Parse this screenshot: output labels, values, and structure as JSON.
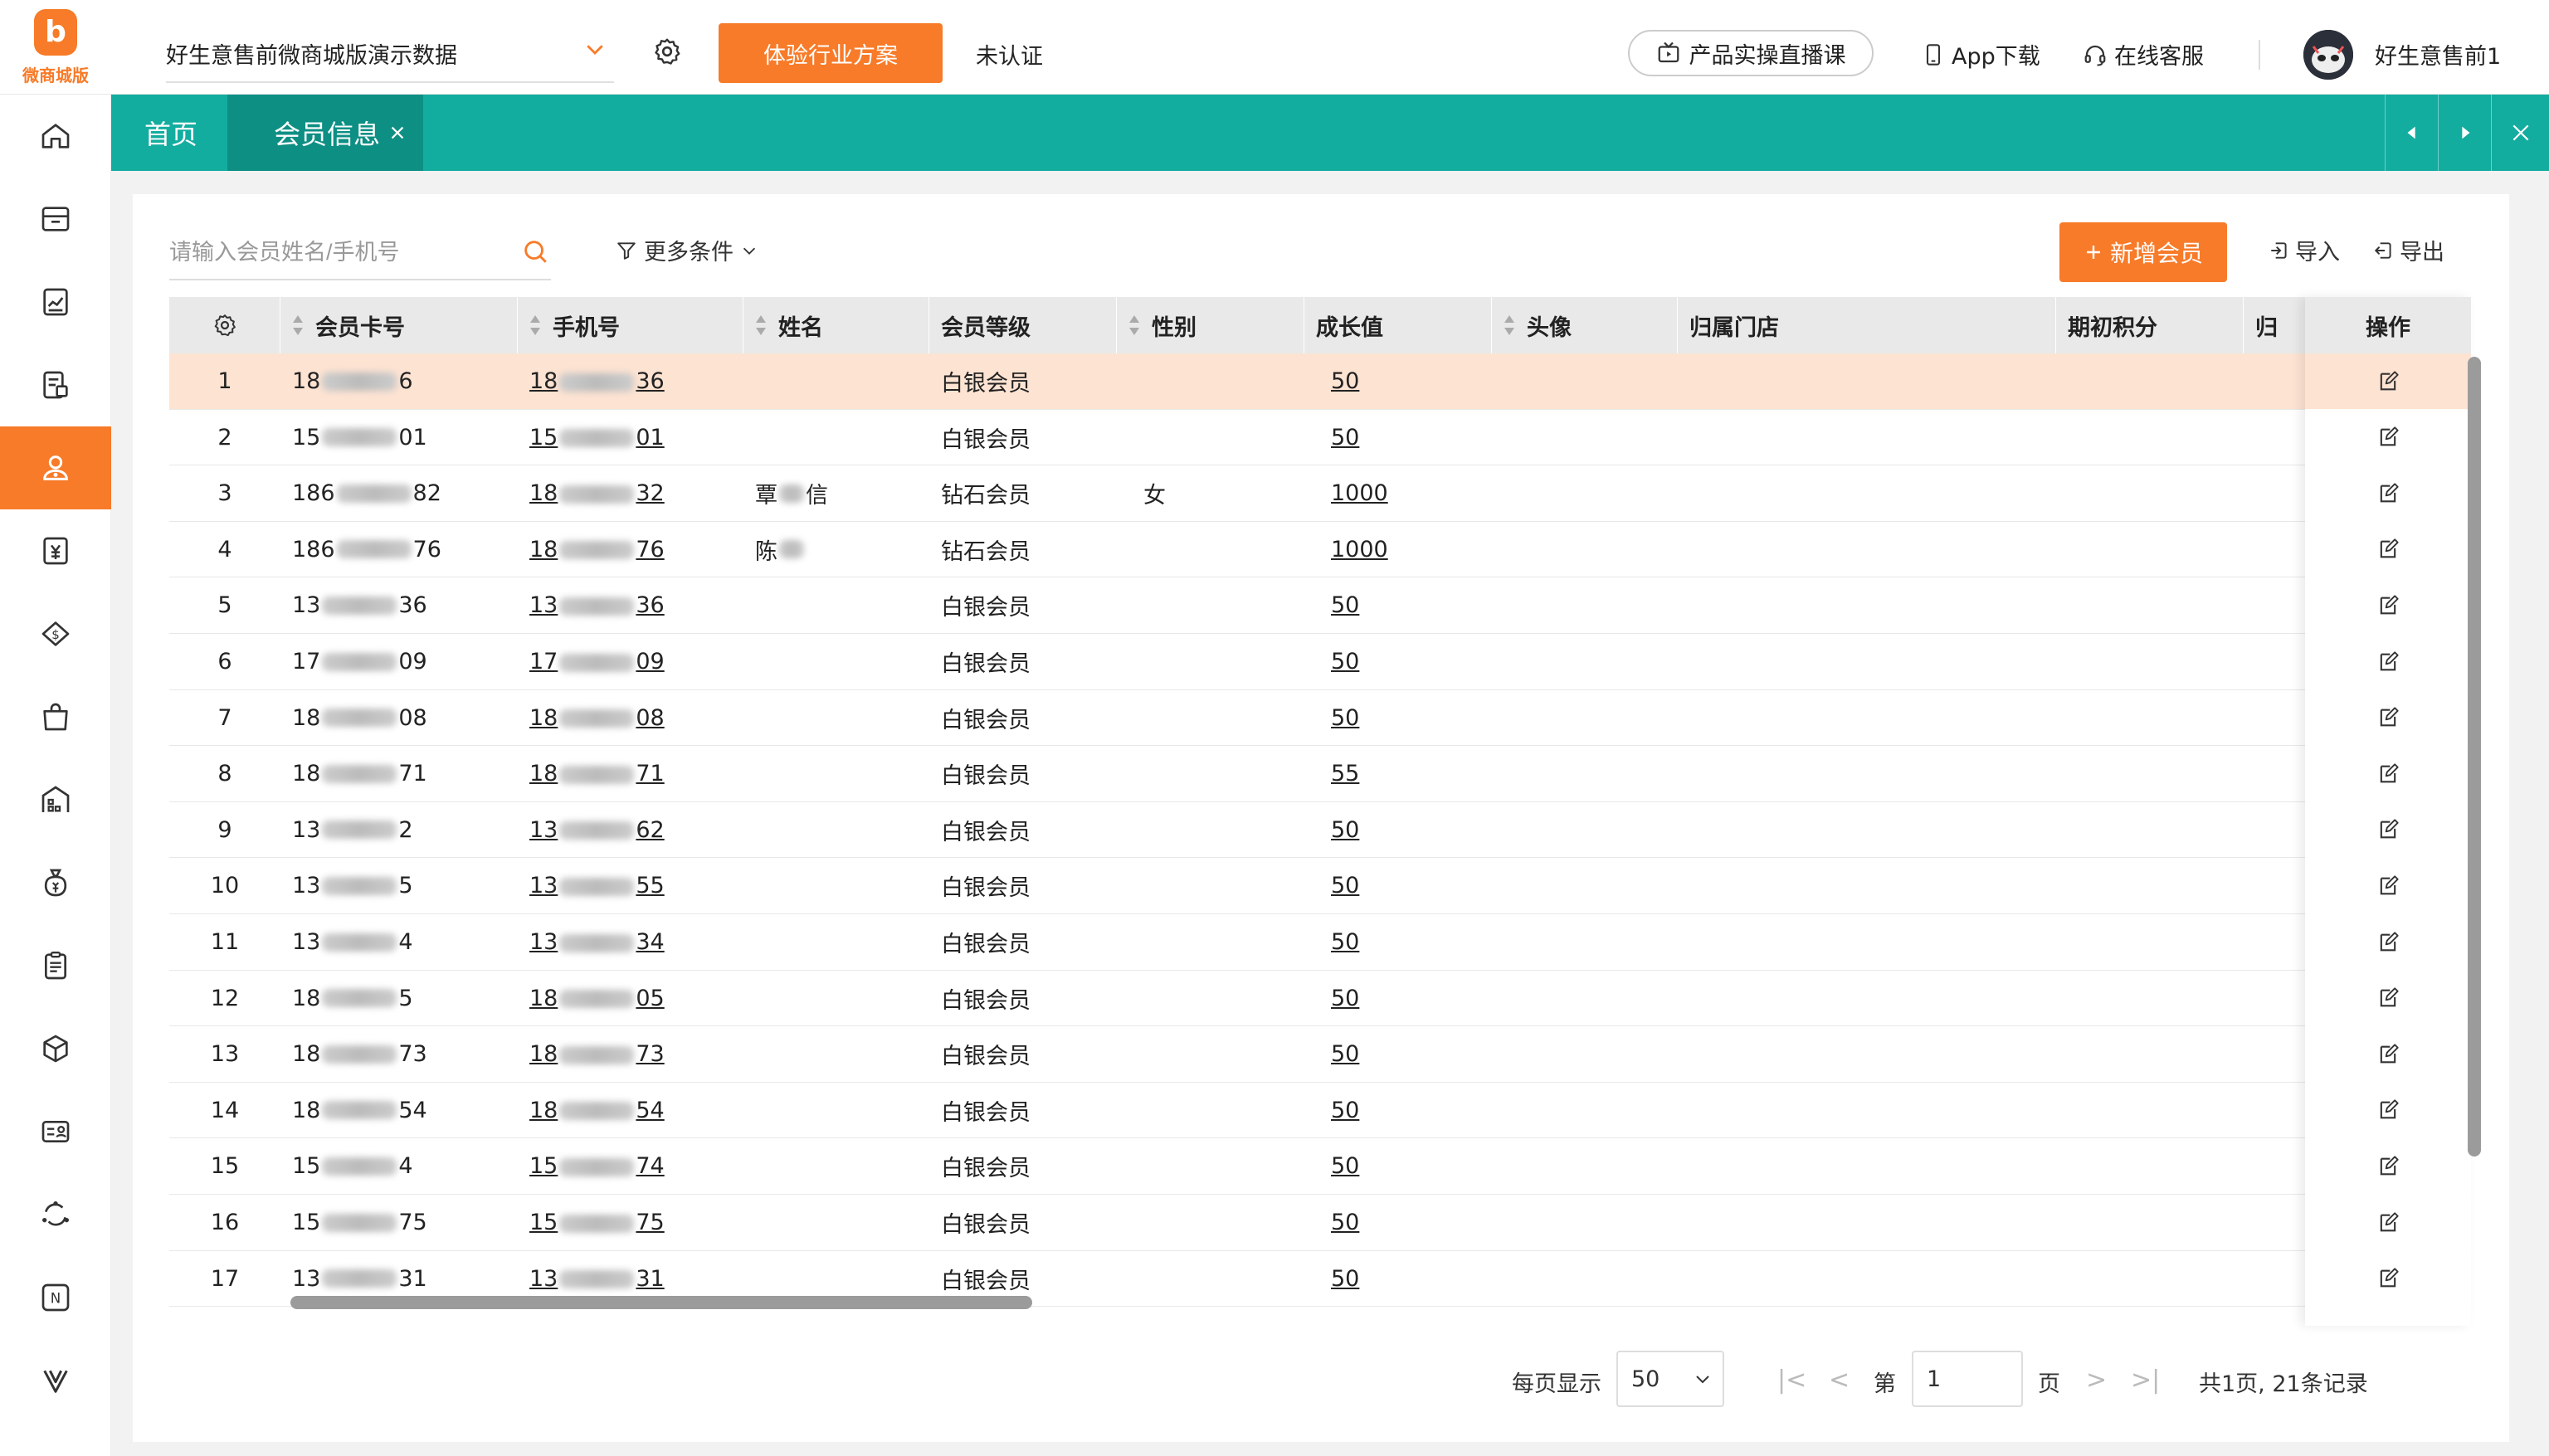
{
  "app": {
    "logo_text": "微商城版",
    "logo_letter": "b"
  },
  "topbar": {
    "store_name": "好生意售前微商城版演示数据",
    "experience_button": "体验行业方案",
    "cert_status": "未认证",
    "live_course": "产品实操直播课",
    "app_download": "App下载",
    "online_service": "在线客服",
    "username": "好生意售前1"
  },
  "sidebar": {
    "items": [
      {
        "icon": "home-icon"
      },
      {
        "icon": "store-icon"
      },
      {
        "icon": "report-icon"
      },
      {
        "icon": "order-icon"
      },
      {
        "icon": "member-icon",
        "active": true
      },
      {
        "icon": "finance-icon"
      },
      {
        "icon": "marketing-icon"
      },
      {
        "icon": "shop-bag-icon"
      },
      {
        "icon": "warehouse-icon"
      },
      {
        "icon": "money-bag-icon"
      },
      {
        "icon": "clipboard-icon"
      },
      {
        "icon": "box-icon"
      },
      {
        "icon": "id-card-icon"
      },
      {
        "icon": "loop-icon"
      },
      {
        "icon": "new-icon"
      },
      {
        "icon": "v-icon"
      }
    ]
  },
  "tabs": {
    "home": "首页",
    "current": "会员信息"
  },
  "toolbar": {
    "search_placeholder": "请输入会员姓名/手机号",
    "more_filter": "更多条件",
    "add_member": "新增会员",
    "import": "导入",
    "export": "导出"
  },
  "table": {
    "headers": {
      "card_no": "会员卡号",
      "phone": "手机号",
      "name": "姓名",
      "level": "会员等级",
      "gender": "性别",
      "growth": "成长值",
      "avatar": "头像",
      "store": "归属门店",
      "initial_points": "期初积分",
      "partial": "归",
      "operation": "操作"
    },
    "rows": [
      {
        "idx": "1",
        "card_pre": "18",
        "card_suf": "6",
        "phone_pre": "18",
        "phone_suf": "36",
        "name_pre": "",
        "name_suf": "",
        "level": "白银会员",
        "gender": "",
        "growth": "50"
      },
      {
        "idx": "2",
        "card_pre": "15",
        "card_suf": "01",
        "phone_pre": "15",
        "phone_suf": "01",
        "name_pre": "",
        "name_suf": "",
        "level": "白银会员",
        "gender": "",
        "growth": "50"
      },
      {
        "idx": "3",
        "card_pre": "186",
        "card_suf": "82",
        "phone_pre": "18",
        "phone_suf": "32",
        "name_pre": "覃",
        "name_suf": "信",
        "level": "钻石会员",
        "gender": "女",
        "growth": "1000"
      },
      {
        "idx": "4",
        "card_pre": "186",
        "card_suf": "76",
        "phone_pre": "18",
        "phone_suf": "76",
        "name_pre": "陈",
        "name_suf": "",
        "level": "钻石会员",
        "gender": "",
        "growth": "1000"
      },
      {
        "idx": "5",
        "card_pre": "13",
        "card_suf": "36",
        "phone_pre": "13",
        "phone_suf": "36",
        "name_pre": "",
        "name_suf": "",
        "level": "白银会员",
        "gender": "",
        "growth": "50"
      },
      {
        "idx": "6",
        "card_pre": "17",
        "card_suf": "09",
        "phone_pre": "17",
        "phone_suf": "09",
        "name_pre": "",
        "name_suf": "",
        "level": "白银会员",
        "gender": "",
        "growth": "50"
      },
      {
        "idx": "7",
        "card_pre": "18",
        "card_suf": "08",
        "phone_pre": "18",
        "phone_suf": "08",
        "name_pre": "",
        "name_suf": "",
        "level": "白银会员",
        "gender": "",
        "growth": "50"
      },
      {
        "idx": "8",
        "card_pre": "18",
        "card_suf": "71",
        "phone_pre": "18",
        "phone_suf": "71",
        "name_pre": "",
        "name_suf": "",
        "level": "白银会员",
        "gender": "",
        "growth": "55"
      },
      {
        "idx": "9",
        "card_pre": "13",
        "card_suf": "2",
        "phone_pre": "13",
        "phone_suf": "62",
        "name_pre": "",
        "name_suf": "",
        "level": "白银会员",
        "gender": "",
        "growth": "50"
      },
      {
        "idx": "10",
        "card_pre": "13",
        "card_suf": "5",
        "phone_pre": "13",
        "phone_suf": "55",
        "name_pre": "",
        "name_suf": "",
        "level": "白银会员",
        "gender": "",
        "growth": "50"
      },
      {
        "idx": "11",
        "card_pre": "13",
        "card_suf": "4",
        "phone_pre": "13",
        "phone_suf": "34",
        "name_pre": "",
        "name_suf": "",
        "level": "白银会员",
        "gender": "",
        "growth": "50"
      },
      {
        "idx": "12",
        "card_pre": "18",
        "card_suf": "5",
        "phone_pre": "18",
        "phone_suf": "05",
        "name_pre": "",
        "name_suf": "",
        "level": "白银会员",
        "gender": "",
        "growth": "50"
      },
      {
        "idx": "13",
        "card_pre": "18",
        "card_suf": "73",
        "phone_pre": "18",
        "phone_suf": "73",
        "name_pre": "",
        "name_suf": "",
        "level": "白银会员",
        "gender": "",
        "growth": "50"
      },
      {
        "idx": "14",
        "card_pre": "18",
        "card_suf": "54",
        "phone_pre": "18",
        "phone_suf": "54",
        "name_pre": "",
        "name_suf": "",
        "level": "白银会员",
        "gender": "",
        "growth": "50"
      },
      {
        "idx": "15",
        "card_pre": "15",
        "card_suf": "4",
        "phone_pre": "15",
        "phone_suf": "74",
        "name_pre": "",
        "name_suf": "",
        "level": "白银会员",
        "gender": "",
        "growth": "50"
      },
      {
        "idx": "16",
        "card_pre": "15",
        "card_suf": "75",
        "phone_pre": "15",
        "phone_suf": "75",
        "name_pre": "",
        "name_suf": "",
        "level": "白银会员",
        "gender": "",
        "growth": "50"
      },
      {
        "idx": "17",
        "card_pre": "13",
        "card_suf": "31",
        "phone_pre": "13",
        "phone_suf": "31",
        "name_pre": "",
        "name_suf": "",
        "level": "白银会员",
        "gender": "",
        "growth": "50"
      }
    ]
  },
  "pager": {
    "per_page_label": "每页显示",
    "per_page_value": "50",
    "page_prefix": "第",
    "page_value": "1",
    "page_suffix": "页",
    "summary": "共1页, 21条记录"
  },
  "colors": {
    "accent": "#f77b29",
    "teal": "#13ada0",
    "teal_dark": "#0e8f84",
    "row_highlight": "#fde3d2"
  }
}
